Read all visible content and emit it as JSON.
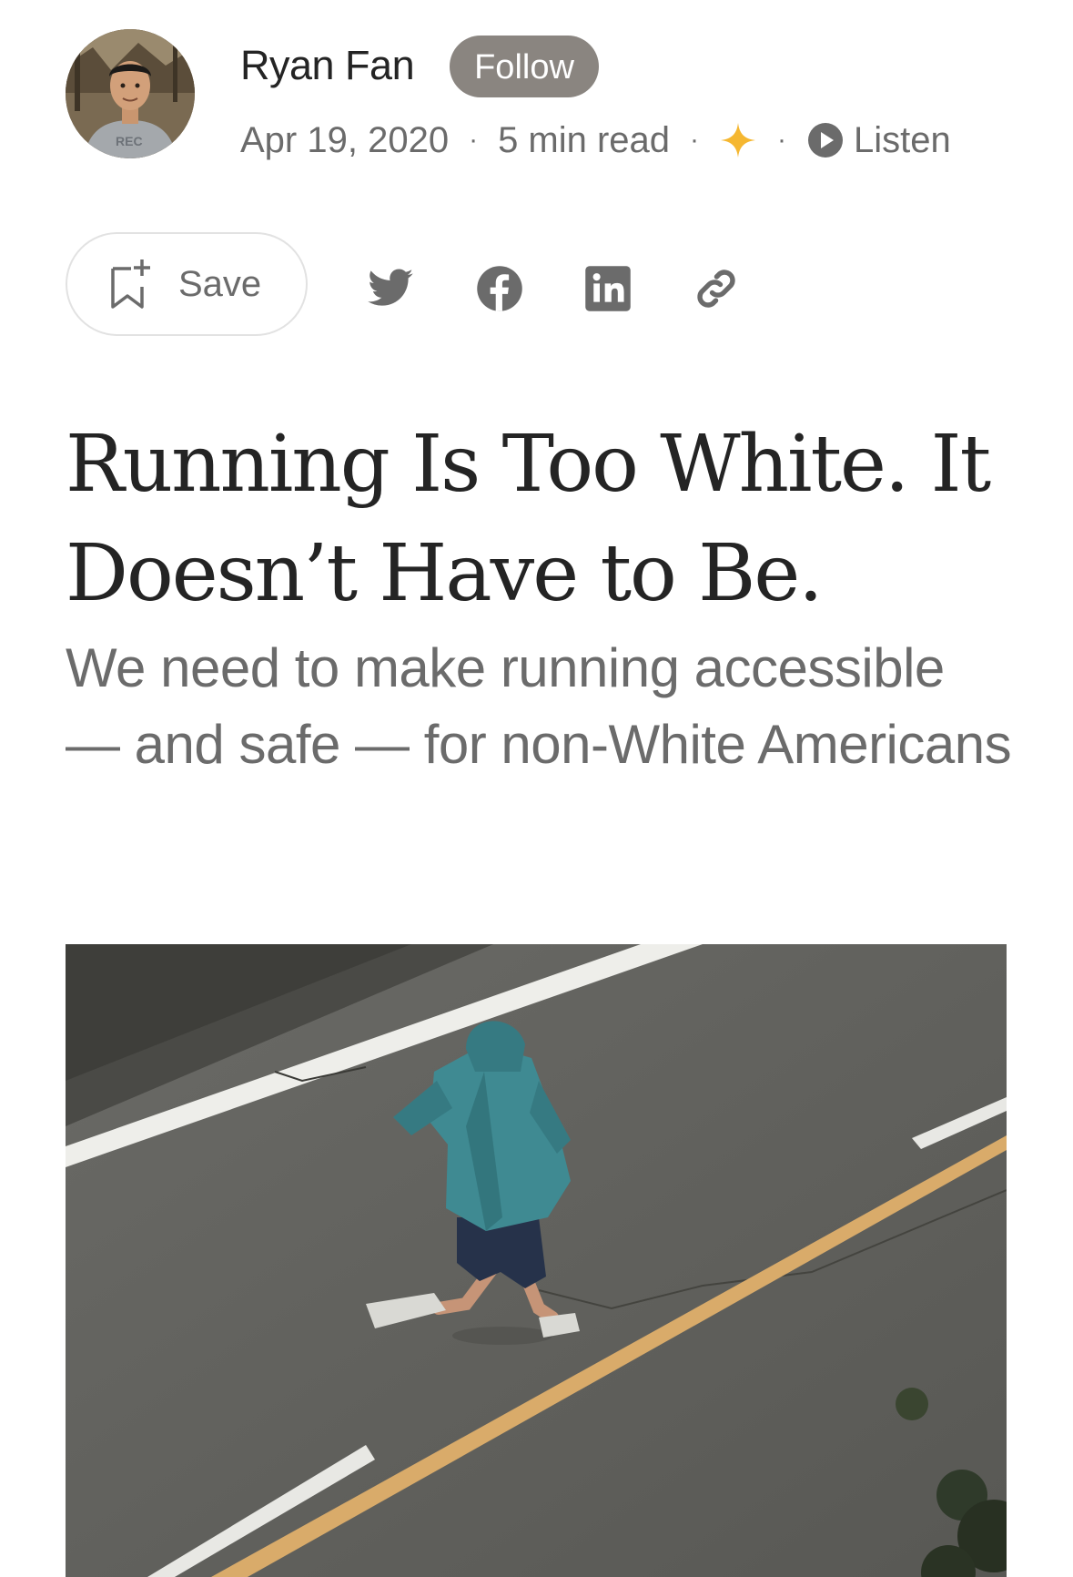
{
  "author": {
    "name": "Ryan Fan",
    "follow_label": "Follow"
  },
  "meta": {
    "date": "Apr 19, 2020",
    "separator": "·",
    "read_time": "5 min read",
    "member_star_icon": "star-icon",
    "listen_label": "Listen",
    "listen_icon": "play-circle-icon"
  },
  "actions": {
    "save_label": "Save",
    "save_icon": "bookmark-add-icon",
    "share_icons": [
      "twitter-icon",
      "facebook-icon",
      "linkedin-icon",
      "link-icon"
    ]
  },
  "article": {
    "title": "Running Is Too White. It Doesn’t Have to Be.",
    "subtitle": "We need to make running accessible — and safe — for non-White Americans"
  },
  "colors": {
    "text_primary": "#242424",
    "text_secondary": "#6b6b6b",
    "follow_bg": "#8a8580",
    "star": "#f5b731",
    "border": "#e2e2e2"
  }
}
